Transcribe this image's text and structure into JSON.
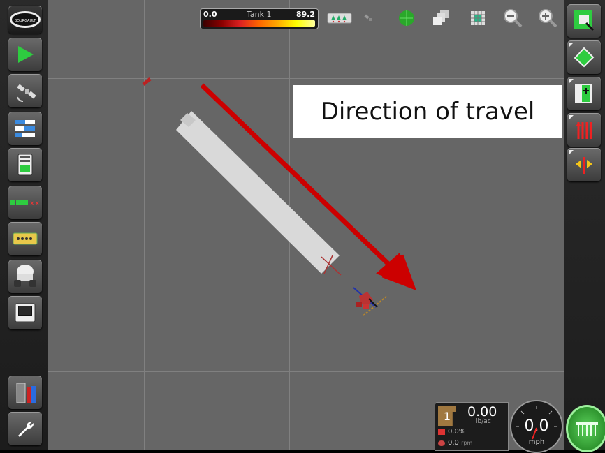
{
  "tank": {
    "min": "0.0",
    "name": "Tank 1",
    "max": "89.2"
  },
  "annotation": {
    "text": "Direction of travel"
  },
  "status": {
    "product_number": "1",
    "rate": "0.00",
    "rate_unit": "lb/ac",
    "percent": "0.0%",
    "rpm_value": "0.0",
    "rpm_unit": "rpm"
  },
  "speed": {
    "value": "0.0",
    "unit": "mph"
  },
  "brand": {
    "logo_text": "BOURGAULT"
  },
  "colors": {
    "map_bg": "#666666",
    "arrow": "#cc0000",
    "coverage": "#d9d9d9",
    "accent_green": "#2ecc40"
  },
  "icons": {
    "left": [
      "bourgault-logo-icon",
      "guidance-play-icon",
      "gps-satellite-icon",
      "settings-list-icon",
      "guidance-screen-icon",
      "section-status-icon",
      "boom-sections-icon",
      "vehicle-icon",
      "display-screen-icon",
      "data-transfer-icon",
      "wrench-icon"
    ],
    "right": [
      "map-view-icon",
      "field-boundary-icon",
      "field-add-icon",
      "rows-icon",
      "swath-adjust-icon"
    ],
    "top": [
      "boom-control-icon",
      "gps-signal-icon",
      "green-globe-icon",
      "layers-icon",
      "grid-icon",
      "zoom-out-icon",
      "zoom-in-icon"
    ]
  }
}
